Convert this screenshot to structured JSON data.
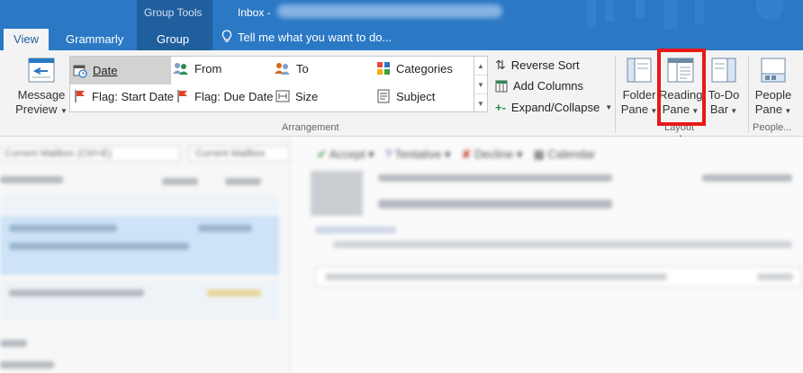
{
  "titlebar": {
    "context_label": "Group Tools",
    "window_title": "Inbox -"
  },
  "tabs": {
    "view": "View",
    "grammarly": "Grammarly",
    "group": "Group",
    "tell_me": "Tell me what you want to do..."
  },
  "ribbon": {
    "message_preview": {
      "line1": "Message",
      "line2": "Preview"
    },
    "arrangement": {
      "label": "Arrangement",
      "items": {
        "date": "Date",
        "from": "From",
        "to": "To",
        "categories": "Categories",
        "flag_start": "Flag: Start Date",
        "flag_due": "Flag: Due Date",
        "size": "Size",
        "subject": "Subject"
      },
      "reverse_sort": "Reverse Sort",
      "add_columns": "Add Columns",
      "expand_collapse": "Expand/Collapse"
    },
    "layout": {
      "label": "Layout",
      "folder_pane": {
        "line1": "Folder",
        "line2": "Pane"
      },
      "reading_pane": {
        "line1": "Reading",
        "line2": "Pane"
      },
      "todo_bar": {
        "line1": "To-Do",
        "line2": "Bar"
      }
    },
    "people": {
      "label": "People...",
      "people_pane": {
        "line1": "People",
        "line2": "Pane"
      }
    }
  },
  "mail": {
    "search_placeholder": "Current Mailbox (Ctrl+E)",
    "scope": "Current Mailbox",
    "respond": {
      "accept": "Accept",
      "tentative": "Tentative",
      "decline": "Decline",
      "calendar": "Calendar"
    }
  },
  "colors": {
    "accent": "#2b78c5",
    "highlight": "#e81919"
  }
}
